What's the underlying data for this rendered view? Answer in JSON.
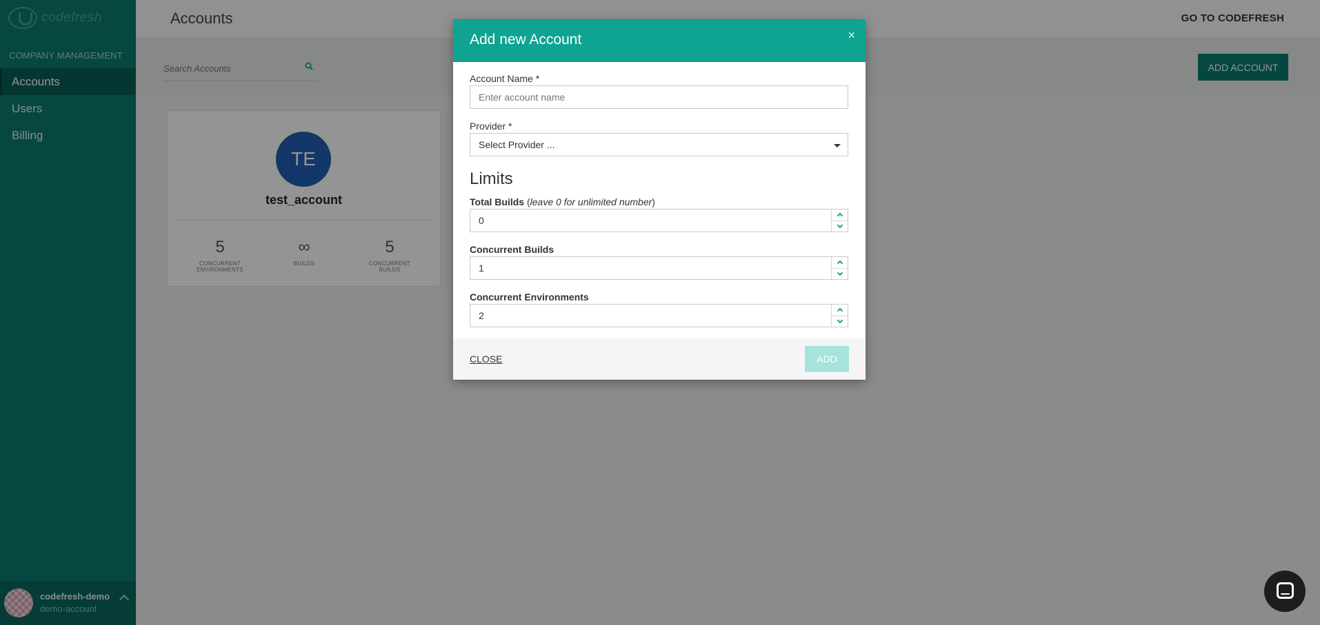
{
  "app": {
    "logo_text": "codefresh",
    "colors": {
      "brand": "#0c7a70",
      "modal_header": "#0fa391",
      "avatar": "#1f5fb3"
    }
  },
  "sidebar": {
    "section_label": "COMPANY MANAGEMENT",
    "items": [
      {
        "label": "Accounts",
        "active": true
      },
      {
        "label": "Users",
        "active": false
      },
      {
        "label": "Billing",
        "active": false
      }
    ],
    "user": {
      "name": "codefresh-demo",
      "account": "demo-account"
    }
  },
  "header": {
    "title": "Accounts",
    "goto_link": "GO TO CODEFRESH"
  },
  "toolbar": {
    "search_placeholder": "Search Accounts",
    "add_account_label": "ADD ACCOUNT"
  },
  "account_card": {
    "initials": "TE",
    "name": "test_account",
    "stats": [
      {
        "value": "5",
        "label_line1": "CONCURRENT",
        "label_line2": "ENVIRONMENTS"
      },
      {
        "value": "∞",
        "label_line1": "BUILDS",
        "label_line2": ""
      },
      {
        "value": "5",
        "label_line1": "CONCURRENT",
        "label_line2": "BUILDS"
      }
    ]
  },
  "modal": {
    "title": "Add new Account",
    "close_icon": "×",
    "account_name": {
      "label": "Account Name *",
      "placeholder": "Enter account name",
      "value": ""
    },
    "provider": {
      "label": "Provider *",
      "selected": "Select Provider ..."
    },
    "limits_heading": "Limits",
    "total_builds": {
      "label": "Total Builds",
      "hint": "leave 0 for unlimited number",
      "value": "0"
    },
    "concurrent_builds": {
      "label": "Concurrent Builds",
      "value": "1"
    },
    "concurrent_environments": {
      "label": "Concurrent Environments",
      "value": "2"
    },
    "close_label": "CLOSE",
    "add_label": "ADD"
  }
}
